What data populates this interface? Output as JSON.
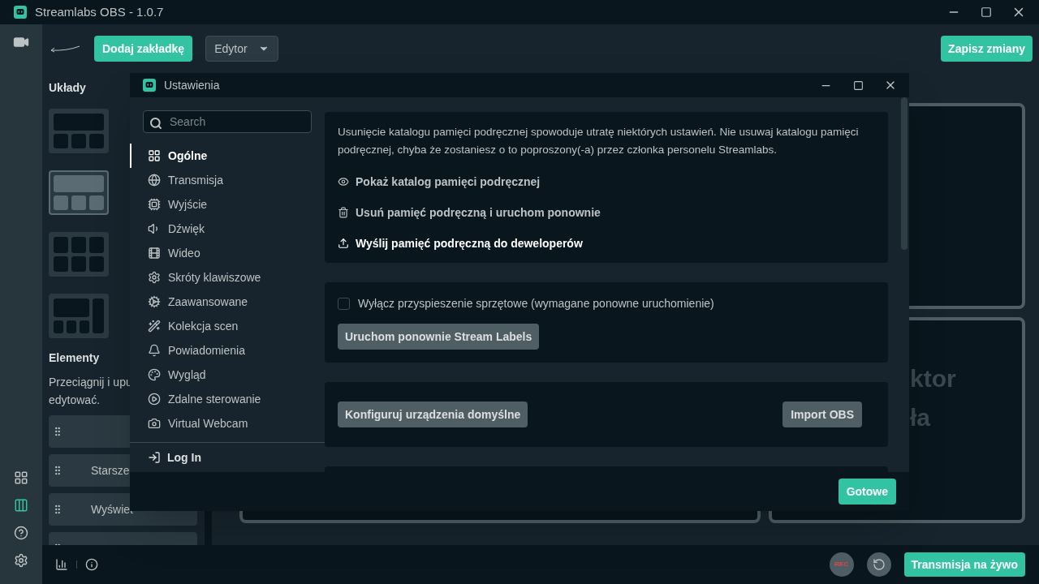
{
  "app": {
    "title": "Streamlabs OBS - 1.0.7"
  },
  "toolbar": {
    "add_tab": "Dodaj zakładkę",
    "editor_dropdown": "Edytor",
    "save": "Zapisz zmiany"
  },
  "layouts_panel": {
    "title": "Układy",
    "layouts": [
      {
        "kind": "top-three",
        "selected": false
      },
      {
        "kind": "top-three",
        "selected": true
      },
      {
        "kind": "grid-six",
        "selected": false
      },
      {
        "kind": "big-side",
        "selected": false
      }
    ],
    "elements_title": "Elementy",
    "hint_line_1": "Przeciągnij i upu",
    "hint_line_2": "edytować.",
    "elements": [
      {
        "kind": "empty"
      },
      {
        "kind": "labeled",
        "label": "Starsze"
      },
      {
        "kind": "labeled",
        "label": "Wyświet"
      },
      {
        "kind": "empty"
      }
    ]
  },
  "editor": {
    "slot_text_1": "ktor",
    "slot_text_2": "ła"
  },
  "left_rail": [
    {
      "kind": "layout",
      "selected": false
    },
    {
      "kind": "columns",
      "selected": true
    },
    {
      "kind": "help",
      "selected": false
    },
    {
      "kind": "settings",
      "selected": false
    }
  ],
  "settings": {
    "title": "Ustawienia",
    "search": {
      "placeholder": "Search"
    },
    "nav": [
      {
        "label": "Ogólne",
        "selected": true
      },
      {
        "label": "Transmisja",
        "selected": false
      },
      {
        "label": "Wyjście",
        "selected": false
      },
      {
        "label": "Dźwięk",
        "selected": false
      },
      {
        "label": "Wideo",
        "selected": false
      },
      {
        "label": "Skróty klawiszowe",
        "selected": false
      },
      {
        "label": "Zaawansowane",
        "selected": false
      },
      {
        "label": "Kolekcja scen",
        "selected": false
      },
      {
        "label": "Powiadomienia",
        "selected": false
      },
      {
        "label": "Wygląd",
        "selected": false
      },
      {
        "label": "Zdalne sterowanie",
        "selected": false
      },
      {
        "label": "Virtual Webcam",
        "selected": false
      }
    ],
    "log_in": "Log In",
    "notice": "Usunięcie katalogu pamięci podręcznej spowoduje utratę niektórych ustawień. Nie usuwaj katalogu pamięci podręcznej, chyba że zostaniesz o to poproszony(-a) przez członka personelu Streamlabs.",
    "actions": [
      {
        "label": "Pokaż katalog pamięci podręcznej",
        "highlighted": false
      },
      {
        "label": "Usuń pamięć podręczną i uruchom ponownie",
        "highlighted": false
      },
      {
        "label": "Wyślij pamięć podręczną do deweloperów",
        "highlighted": true
      }
    ],
    "hardware_checkbox": {
      "label": "Wyłącz przyspieszenie sprzętowe (wymagane ponowne uruchomienie)",
      "checked": false
    },
    "restart_labels": "Uruchom ponownie Stream Labels",
    "configure_devices": "Konfiguruj urządzenia domyślne",
    "import_obs": "Import OBS",
    "done": "Gotowe"
  },
  "bottom_bar": {
    "rec": "REC",
    "go_live": "Transmisja na żywo"
  }
}
